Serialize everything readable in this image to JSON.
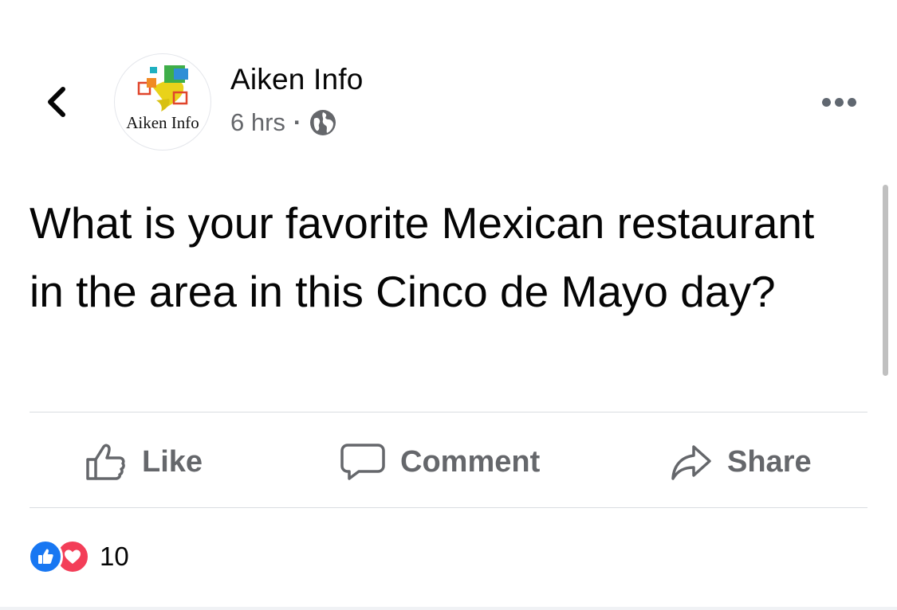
{
  "header": {
    "page_name": "Aiken Info",
    "avatar_text": "Aiken Info",
    "time": "6 hrs",
    "separator": "·",
    "privacy_icon": "globe-icon",
    "back_icon": "chevron-left-icon",
    "more_icon": "more-horizontal-icon"
  },
  "post": {
    "text": "What is your favorite Mexican restaurant in the area in this Cinco de Mayo day?"
  },
  "actions": {
    "like_label": "Like",
    "comment_label": "Comment",
    "share_label": "Share"
  },
  "reactions": {
    "icons": [
      "like-reaction-icon",
      "love-reaction-icon"
    ],
    "count": "10"
  },
  "colors": {
    "secondary_text": "#65676b",
    "like_blue": "#1877f2",
    "love_red": "#f33e58",
    "divider": "#dadde1"
  }
}
